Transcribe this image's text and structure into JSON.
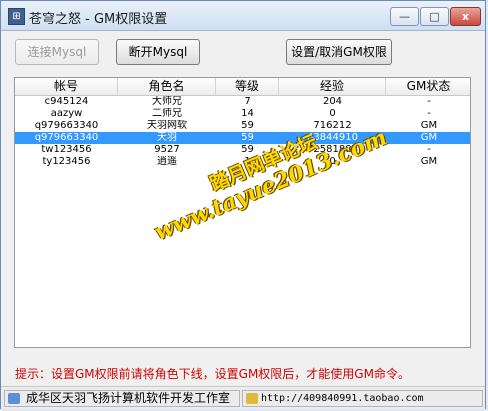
{
  "window": {
    "title": "苍穹之怒 - GM权限设置",
    "minimize": "—",
    "maximize": "□",
    "close": "x"
  },
  "toolbar": {
    "connect_label": "连接Mysql",
    "disconnect_label": "断开Mysql",
    "gm_label": "设置/取消GM权限"
  },
  "table": {
    "columns": [
      "帐号",
      "角色名",
      "等级",
      "经验",
      "GM状态"
    ],
    "rows": [
      [
        "c945124",
        "大师兄",
        "7",
        "204",
        "-"
      ],
      [
        "aazyw",
        "二师兄",
        "14",
        "0",
        "-"
      ],
      [
        "q979663340",
        "天羽网软",
        "59",
        "716212",
        "GM"
      ],
      [
        "q979663340",
        "天羽",
        "59",
        "83844910",
        "GM"
      ],
      [
        "tw123456",
        "9527",
        "59",
        "72581888",
        "-"
      ],
      [
        "ty123456",
        "逍遥",
        "1",
        "0",
        "GM"
      ]
    ],
    "selected_index": 3
  },
  "watermark": {
    "line1": "踏月网单论坛",
    "line2": "www.tayue2013.com"
  },
  "hint": "提示：设置GM权限前请将角色下线，设置GM权限后，才能使用GM命令。",
  "status": {
    "left_text": "成华区天羽飞扬计算机软件开发工作室",
    "right_text": "http://409840991.taobao.com"
  },
  "colors": {
    "selected_row": "#3399ff",
    "hint_red": "#d40000",
    "watermark": "#ffd800"
  },
  "icons": {
    "app": "app-icon",
    "status_left": "user-icon",
    "status_right": "link-icon"
  }
}
